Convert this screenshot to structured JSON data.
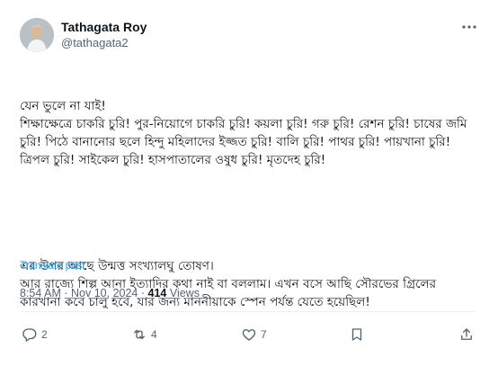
{
  "author": {
    "name": "Tathagata Roy",
    "handle": "@tathagata2"
  },
  "tweet": {
    "paragraphs": [
      "যেন ভুলে না যাই!\nশিক্ষাক্ষেত্রে চাকরি চুরি! পুর-নিয়োগে চাকরি চুরি! কয়লা চুরি! গরু চুরি! রেশন চুরি! চাষের জমি চুরি! পিঠে বানানোর ছলে হিন্দু মহিলাদের ইজ্জত চুরি! বালি চুরি! পাথর চুরি! পায়খানা চুরি! ত্রিপল চুরি! সাইকেল চুরি! হাসপাতালের ওষুধ চুরি! মৃতদেহ চুরি!",
      "এর উপর আছে উন্মত্ত সংখ্যালঘু তোষণ।\nআর রাজ্যে শিল্প আনা ইত্যাদির কথা নাই বা বললাম। এখন বসে আছি সৌরভের গ্রিলের কারখানা কবে চালু হবে, যার জন্য মাননীয়াকে স্পেন পর্যন্ত যেতে হয়েছিল!"
    ],
    "translate_label": "Translate post",
    "time": "8:54 AM",
    "separator": "·",
    "date": "Nov 10, 2024",
    "views_count": "414",
    "views_label": "Views"
  },
  "actions": {
    "replies": "2",
    "reposts": "4",
    "likes": "7",
    "bookmarks": "",
    "share": ""
  },
  "icons": [
    "more-icon",
    "reply-icon",
    "repost-icon",
    "like-icon",
    "bookmark-icon",
    "share-icon"
  ],
  "colors": {
    "link": "#1d9bf0",
    "secondary": "#536471",
    "text": "#0f1419"
  }
}
